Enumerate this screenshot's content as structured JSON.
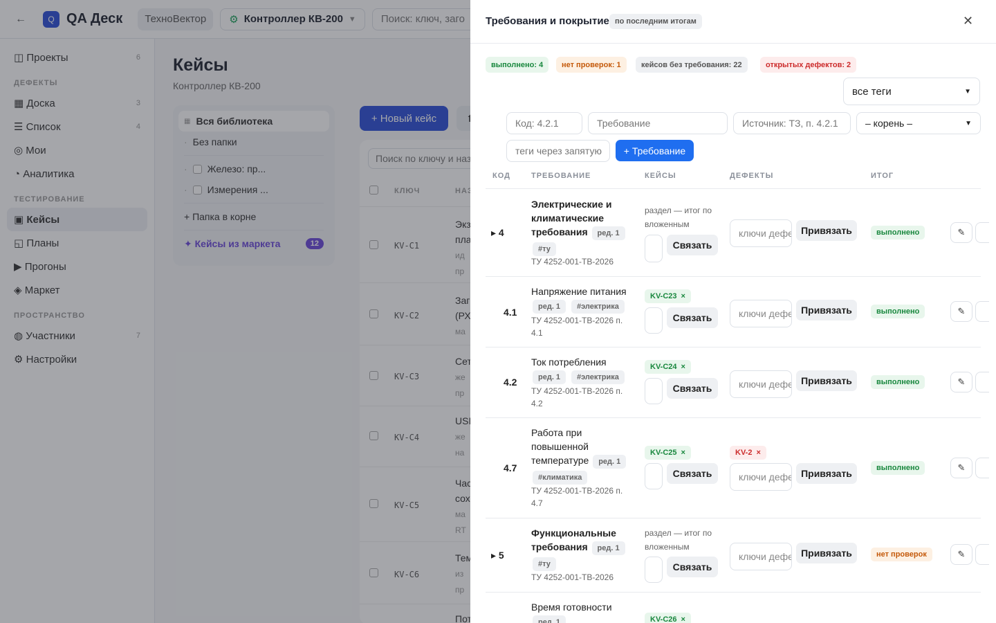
{
  "topbar": {
    "back_icon": "←",
    "logo_letter": "Q",
    "brand": "QA Деск",
    "org": "ТехноВектор",
    "project": "Контроллер КВ-200",
    "search_placeholder": "Поиск: ключ, заго"
  },
  "sidebar": {
    "items_top": [
      {
        "icon": "◫",
        "label": "Проекты",
        "count": "6"
      }
    ],
    "sec_defects": "ДЕФЕКТЫ",
    "items_defects": [
      {
        "icon": "▦",
        "label": "Доска",
        "count": "3"
      },
      {
        "icon": "☰",
        "label": "Список",
        "count": "4"
      },
      {
        "icon": "◎",
        "label": "Мои",
        "count": ""
      },
      {
        "icon": "◔",
        "label": "Аналитика",
        "count": ""
      }
    ],
    "sec_testing": "ТЕСТИРОВАНИЕ",
    "items_testing": [
      {
        "icon": "▣",
        "label": "Кейсы"
      },
      {
        "icon": "◱",
        "label": "Планы"
      },
      {
        "icon": "▶",
        "label": "Прогоны"
      },
      {
        "icon": "◈",
        "label": "Маркет"
      }
    ],
    "sec_space": "ПРОСТРАНСТВО",
    "items_space": [
      {
        "icon": "◍",
        "label": "Участники",
        "count": "7"
      },
      {
        "icon": "⚙",
        "label": "Настройки",
        "count": ""
      }
    ]
  },
  "main": {
    "title": "Кейсы",
    "subtitle": "Контроллер КВ-200",
    "tree": {
      "all": "Вся библиотека",
      "nofolder": "Без папки",
      "f1": "Железо: пр...",
      "f2": "Измерения ...",
      "root": "+ Папка в корне",
      "market": "✦ Кейсы из маркета",
      "market_count": "12"
    },
    "new_case": "+ Новый кейс",
    "search_placeholder": "Поиск по ключу и наз",
    "col_key": "КЛЮЧ",
    "col_name": "НАЗ",
    "cases": [
      {
        "key": "KV-C1",
        "l1": "Экз",
        "l2": "пла",
        "l3": "ид",
        "l4": "пр"
      },
      {
        "key": "KV-C2",
        "l1": "Заг",
        "l2": "(РХ",
        "l3": "ма",
        "l4": ""
      },
      {
        "key": "KV-C3",
        "l1": "Сет",
        "l2": "же",
        "l3": "пр",
        "l4": ""
      },
      {
        "key": "KV-C4",
        "l1": "USI",
        "l2": "же",
        "l3": "на",
        "l4": ""
      },
      {
        "key": "KV-C5",
        "l1": "Час",
        "l2": "сох",
        "l3": "ма",
        "l4": "RT"
      },
      {
        "key": "KV-C6",
        "l1": "Тем",
        "l2": "из",
        "l3": "пр",
        "l4": ""
      },
      {
        "key": "",
        "l1": "Пот",
        "l2": "",
        "l3": "",
        "l4": ""
      }
    ]
  },
  "drawer": {
    "title": "Требования и покрытие",
    "title_tag": "по последним итогам",
    "close_icon": "✕",
    "chips": {
      "done": "выполнено: 4",
      "nocheck": "нет проверок: 1",
      "nocase": "кейсов без требования: 22",
      "defects": "открытых дефектов: 2"
    },
    "filter_tags": "все теги",
    "form": {
      "code_ph": "Код: 4.2.1",
      "req_ph": "Требование",
      "src_ph": "Источник: ТЗ, п. 4.2.1",
      "parent": "– корень –",
      "tags_ph": "теги через запятую",
      "add_btn": "+ Требование"
    },
    "cols": {
      "code": "КОД",
      "req": "ТРЕБОВАНИЕ",
      "cases": "КЕЙСЫ",
      "defects": "ДЕФЕКТЫ",
      "result": "ИТОГ"
    },
    "defect_ph": "ключи дефектов",
    "link_label": "Связать",
    "bind_label": "Привязать",
    "edit_icon": "✎",
    "rows": [
      {
        "code": "▸ 4",
        "title": "Электрические и климатические требования",
        "rev": "ред. 1",
        "tag": "#ту",
        "src": "ТУ 4252-001-ТВ-2026",
        "note": "раздел — итог по вложенным",
        "cases": [],
        "defects": [],
        "status": "выполнено"
      },
      {
        "code": "4.1",
        "title": "Напряжение питания",
        "rev": "ред. 1",
        "tag": "#электрика",
        "src": "ТУ 4252-001-ТВ-2026 п. 4.1",
        "note": "",
        "cases": [
          "KV-C23"
        ],
        "defects": [],
        "status": "выполнено"
      },
      {
        "code": "4.2",
        "title": "Ток потребления",
        "rev": "ред. 1",
        "tag": "#электрика",
        "src": "ТУ 4252-001-ТВ-2026 п. 4.2",
        "note": "",
        "cases": [
          "KV-C24"
        ],
        "defects": [],
        "status": "выполнено"
      },
      {
        "code": "4.7",
        "title": "Работа при повышенной температуре",
        "rev": "ред. 1",
        "tag": "#климатика",
        "src": "ТУ 4252-001-ТВ-2026 п. 4.7",
        "note": "",
        "cases": [
          "KV-C25"
        ],
        "defects": [
          "KV-2"
        ],
        "status": "выполнено"
      },
      {
        "code": "▸ 5",
        "title": "Функциональные требования",
        "rev": "ред. 1",
        "tag": "#ту",
        "src": "ТУ 4252-001-ТВ-2026",
        "note": "раздел — итог по вложенным",
        "cases": [],
        "defects": [],
        "status": "нет проверок"
      },
      {
        "code": "",
        "title": "Время готовности",
        "rev": "ред. 1",
        "tag": "",
        "src": "",
        "note": "",
        "cases": [
          "KV-C26"
        ],
        "defects": [],
        "status": ""
      }
    ],
    "colors": {
      "accent": "#1f6ef0",
      "brand": "#2b4fd8",
      "green": "#18873d",
      "orange": "#c4590a",
      "red": "#cc2b2b",
      "purple": "#6a47d9"
    }
  }
}
